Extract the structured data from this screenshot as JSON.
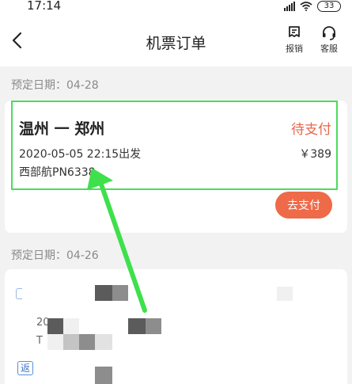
{
  "status_bar": {
    "time": "17:14",
    "battery": "33",
    "icons": [
      "signal-icon",
      "wifi-icon",
      "battery-icon"
    ]
  },
  "header": {
    "back_icon": "chevron-left-icon",
    "title": "机票订单",
    "actions": [
      {
        "label": "报销",
        "icon": "receipt-icon"
      },
      {
        "label": "客服",
        "icon": "headset-icon"
      }
    ]
  },
  "orders": [
    {
      "booking_date": "预定日期：04-28",
      "route": "温州 一 郑州",
      "status": "待支付",
      "departure": "2020-05-05 22:15出发",
      "price": "￥389",
      "flight": "西部航PN6338",
      "action_label": "去支付"
    },
    {
      "booking_date": "预定日期：04-26",
      "partial_text_1": "20",
      "partial_text_2": "T",
      "tag": "返"
    }
  ],
  "colors": {
    "accent": "#ef6a48",
    "status": "#e8664a",
    "highlight": "#4cdc5a",
    "background": "#f2f2f2"
  }
}
